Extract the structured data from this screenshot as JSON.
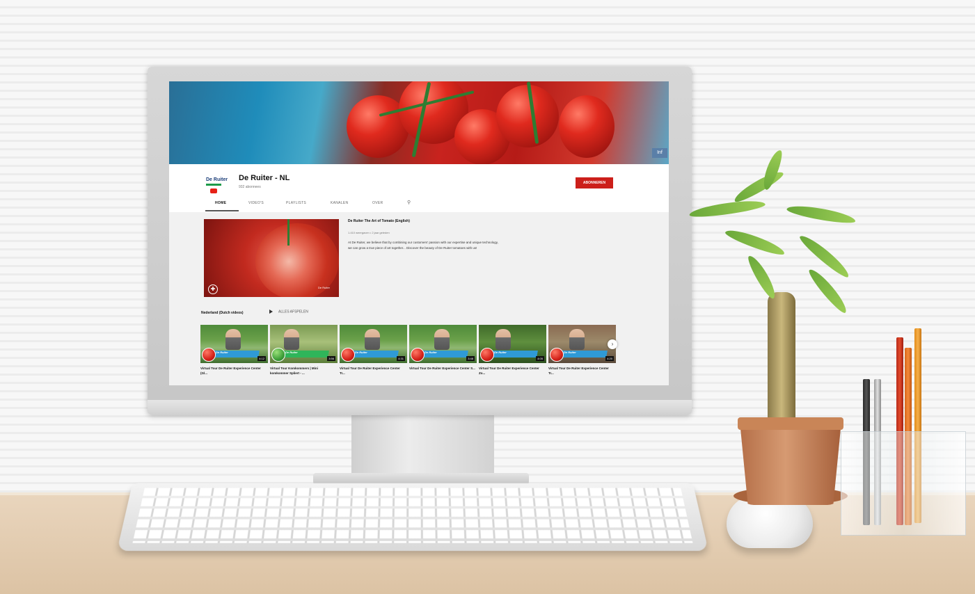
{
  "channel": {
    "name": "De Ruiter - NL",
    "subscribers": "932 abonnees",
    "logo_text": "De Ruiter",
    "subscribe_label": "ABONNEREN",
    "banner_chip": "Inf"
  },
  "tabs": [
    {
      "label": "HOME",
      "active": true
    },
    {
      "label": "VIDEO'S"
    },
    {
      "label": "PLAYLISTS"
    },
    {
      "label": "KANALEN"
    },
    {
      "label": "OVER"
    }
  ],
  "featured": {
    "title": "De Ruiter The Art of Tomato (English)",
    "meta": "1.410 weergaven • 2 jaar geleden",
    "description": "At De Ruiter, we believe that by combining our customers' passion with our expertise and unique technology, we can grow a true piece of art together... Discover the beauty of De Ruiter tomatoes with us!",
    "watermark": "De Ruiter"
  },
  "shelf": {
    "title": "Nederland (Dutch videos)",
    "play_all": "ALLES AFSPELEN",
    "videos": [
      {
        "title": "Virtual Tour De Ruiter Experience Center (Gl...",
        "duration": "4:12",
        "strip": "De Ruiter"
      },
      {
        "title": "Virtual Tour Komkommers | Mini komkommer Spliert - ...",
        "duration": "3:56",
        "strip": "De Ruiter"
      },
      {
        "title": "Virtual Tour De Ruiter Experience Center Tr...",
        "duration": "4:31",
        "strip": "De Ruiter"
      },
      {
        "title": "Virtual Tour De Ruiter Experience Center S...",
        "duration": "3:48",
        "strip": "De Ruiter"
      },
      {
        "title": "Virtual Tour De Ruiter Experience Center Zo...",
        "duration": "4:05",
        "strip": "De Ruiter"
      },
      {
        "title": "Virtual Tour De Ruiter Experience Center Tr...",
        "duration": "4:20",
        "strip": "De Ruiter"
      }
    ]
  },
  "colors": {
    "subscribe": "#cc1f1a",
    "accent_blue": "#2f9ad6"
  }
}
